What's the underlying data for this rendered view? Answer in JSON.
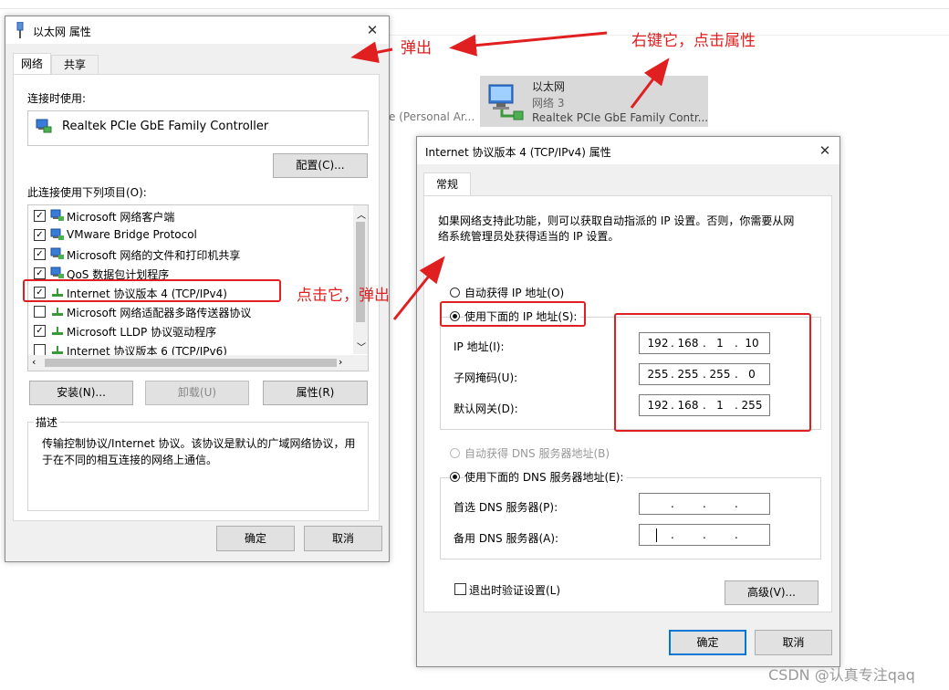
{
  "background": {
    "personal_text": "e (Personal Ar...",
    "adapter": {
      "name": "以太网",
      "network": "网络 3",
      "device": "Realtek PCIe GbE Family Contr..."
    }
  },
  "props_dialog": {
    "title": "以太网 属性",
    "tabs": [
      "网络",
      "共享"
    ],
    "connect_using_label": "连接时使用:",
    "adapter_name": "Realtek PCIe GbE Family Controller",
    "configure_label": "配置(C)...",
    "items_label": "此连接使用下列项目(O):",
    "items": [
      {
        "label": "Microsoft 网络客户端",
        "checked": true
      },
      {
        "label": "VMware Bridge Protocol",
        "checked": true
      },
      {
        "label": "Microsoft 网络的文件和打印机共享",
        "checked": true
      },
      {
        "label": "QoS 数据包计划程序",
        "checked": true
      },
      {
        "label": "Internet 协议版本 4 (TCP/IPv4)",
        "checked": true
      },
      {
        "label": "Microsoft 网络适配器多路传送器协议",
        "checked": false
      },
      {
        "label": "Microsoft LLDP 协议驱动程序",
        "checked": true
      },
      {
        "label": "Internet 协议版本 6 (TCP/IPv6)",
        "checked": false
      }
    ],
    "install_label": "安装(N)...",
    "uninstall_label": "卸载(U)",
    "properties_label": "属性(R)",
    "description_title": "描述",
    "description_text": "传输控制协议/Internet 协议。该协议是默认的广域网络协议，用于在不同的相互连接的网络上通信。",
    "ok_label": "确定",
    "cancel_label": "取消"
  },
  "ipv4_dialog": {
    "title": "Internet 协议版本 4 (TCP/IPv4) 属性",
    "tab": "常规",
    "intro_line1": "如果网络支持此功能，则可以获取自动指派的 IP 设置。否则，你需要从网",
    "intro_line2": "络系统管理员处获得适当的 IP 设置。",
    "auto_ip_label": "自动获得 IP 地址(O)",
    "manual_ip_label": "使用下面的 IP 地址(S):",
    "ip_label": "IP 地址(I):",
    "ip_octets": [
      "192",
      "168",
      "1",
      "10"
    ],
    "mask_label": "子网掩码(U):",
    "mask_octets": [
      "255",
      "255",
      "255",
      "0"
    ],
    "gateway_label": "默认网关(D):",
    "gateway_octets": [
      "192",
      "168",
      "1",
      "255"
    ],
    "auto_dns_label": "自动获得 DNS 服务器地址(B)",
    "manual_dns_label": "使用下面的 DNS 服务器地址(E):",
    "preferred_dns_label": "首选 DNS 服务器(P):",
    "alternate_dns_label": "备用 DNS 服务器(A):",
    "dot": ".",
    "validate_label": "退出时验证设置(L)",
    "advanced_label": "高级(V)...",
    "ok_label": "确定",
    "cancel_label": "取消"
  },
  "annotations": {
    "popup1": "弹出",
    "right_click": "右键它，点击属性",
    "click_popup": "点击它，弹出",
    "color": "#e02020"
  },
  "watermark": "CSDN @认真专注qaq"
}
